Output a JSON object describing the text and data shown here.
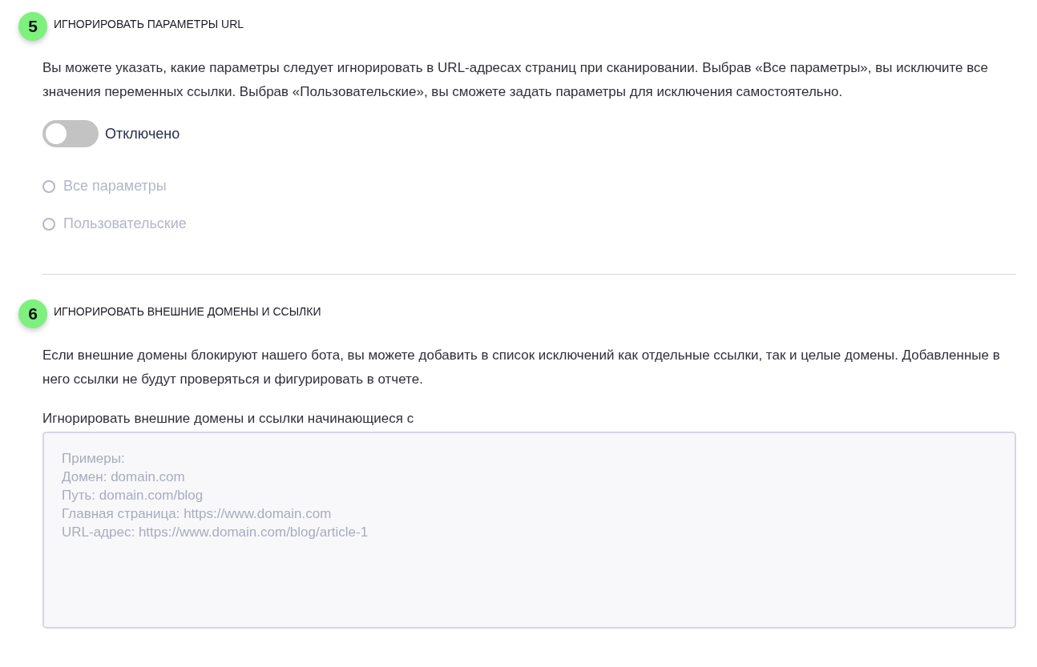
{
  "sections": [
    {
      "kind": "url-params",
      "number": "5",
      "title": "ИГНОРИРОВАТЬ ПАРАМЕТРЫ URL",
      "description": "Вы можете указать, какие параметры следует игнорировать в URL-адресах страниц при сканировании. Выбрав «Все параметры», вы исключите все значения переменных ссылки. Выбрав «Пользовательские», вы сможете задать параметры для исключения самостоятельно.",
      "toggle": {
        "label": "Отключено",
        "on": false
      },
      "options": [
        {
          "label": "Все параметры",
          "selected": false,
          "disabled": true
        },
        {
          "label": "Пользовательские",
          "selected": false,
          "disabled": true
        }
      ]
    },
    {
      "kind": "external-domains",
      "number": "6",
      "title": "ИГНОРИРОВАТЬ ВНЕШНИЕ ДОМЕНЫ И ССЫЛКИ",
      "description": "Если внешние домены блокируют нашего бота, вы можете добавить в список исключений как отдельные ссылки, так и целые домены. Добавленные в него ссылки не будут проверяться и фигурировать в отчете.",
      "field": {
        "label": "Игнорировать внешние домены и ссылки начинающиеся с",
        "placeholder": "Примеры:\nДомен: domain.com\nПуть: domain.com/blog\nГлавная страница: https://www.domain.com\nURL-адрес: https://www.domain.com/blog/article-1"
      }
    }
  ]
}
